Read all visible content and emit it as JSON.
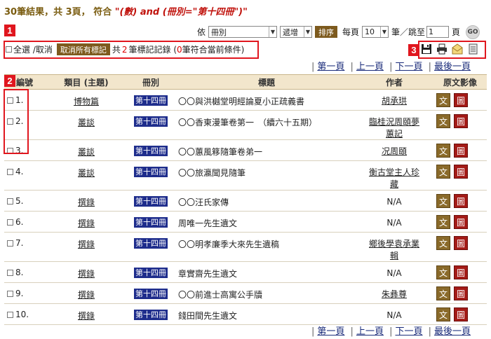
{
  "header": {
    "result_prefix": "30筆結果，共 3頁， 符合 ",
    "query": "\"(數) and (冊別=\"第十四冊\")\""
  },
  "sort_controls": {
    "label_sort_by": "依",
    "sort_field": "冊別",
    "sort_order": "遞增",
    "sort_button": "排序",
    "per_page_label": "每頁",
    "per_page": "10",
    "pen_jump_label": "筆／跳至",
    "page_input": "1",
    "page_unit": "頁",
    "go_label": "GO"
  },
  "marker_bar": {
    "select_all": "全選 /取消",
    "clear_marks": "取消所有標記",
    "summary_prefix": "共",
    "marked_count": "2",
    "summary_mid": "筆標記記錄 (",
    "matching_count": "0",
    "summary_suffix": "筆符合當前條件)"
  },
  "pager": {
    "first": "第一頁",
    "prev": "上一頁",
    "next": "下一頁",
    "last": "最後一頁"
  },
  "callouts": {
    "one": "1",
    "two": "2",
    "three": "3"
  },
  "columns": {
    "no": "編號",
    "category": "類目 (主題)",
    "volume": "冊別",
    "title": "標題",
    "author": "作者",
    "images": "原文影像"
  },
  "buttons": {
    "text_label": "文",
    "image_label": "圖"
  },
  "rows": [
    {
      "no": "1.",
      "category": "博物篇",
      "volume": "第十四冊",
      "title": "〇〇與洪樾堂明經論夏小正疏義書",
      "author_line1": "胡承珙",
      "author_line2": "",
      "author_link": true
    },
    {
      "no": "2.",
      "category": "叢談",
      "volume": "第十四冊",
      "title": "〇〇香東漫筆卷第一　（續六十五期）",
      "author_line1": "臨桂況周頤夢",
      "author_line2": "蕙記",
      "author_link": true
    },
    {
      "no": "3.",
      "category": "叢談",
      "volume": "第十四冊",
      "title": "〇〇蕙風簃隨筆卷弟一",
      "author_line1": "况周頤",
      "author_line2": "",
      "author_link": true
    },
    {
      "no": "4.",
      "category": "叢談",
      "volume": "第十四冊",
      "title": "〇〇旅瀛聞見隨筆",
      "author_line1": "衡古堂主人珍",
      "author_line2": "藏",
      "author_link": true
    },
    {
      "no": "5.",
      "category": "撰錄",
      "volume": "第十四冊",
      "title": "〇〇汪氏家傳",
      "author_line1": "N/A",
      "author_line2": "",
      "author_link": false
    },
    {
      "no": "6.",
      "category": "撰錄",
      "volume": "第十四冊",
      "title": "周唯一先生遺文",
      "author_line1": "N/A",
      "author_line2": "",
      "author_link": false
    },
    {
      "no": "7.",
      "category": "撰錄",
      "volume": "第十四冊",
      "title": "〇〇明孝廉季大來先生遺稿",
      "author_line1": "鄉後學袁承業",
      "author_line2": "輯",
      "author_link": true
    },
    {
      "no": "8.",
      "category": "撰錄",
      "volume": "第十四冊",
      "title": "章實齋先生遺文",
      "author_line1": "N/A",
      "author_line2": "",
      "author_link": false
    },
    {
      "no": "9.",
      "category": "撰錄",
      "volume": "第十四冊",
      "title": "〇〇前進士高寓公手牘",
      "author_line1": "朱彝尊",
      "author_line2": "",
      "author_link": true
    },
    {
      "no": "10.",
      "category": "撰錄",
      "volume": "第十四冊",
      "title": "錢田間先生遺文",
      "author_line1": "N/A",
      "author_line2": "",
      "author_link": false
    }
  ]
}
